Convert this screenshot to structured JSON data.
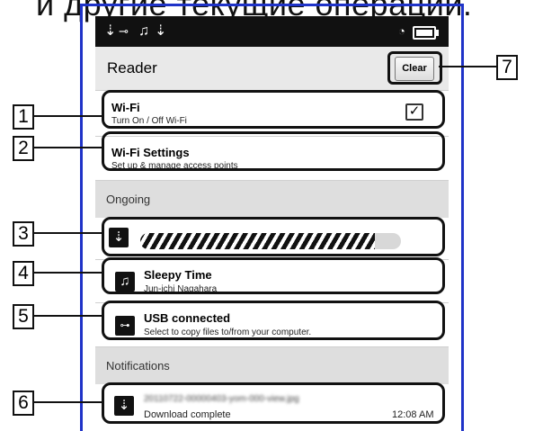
{
  "page": {
    "caption": "и другие текущие операции."
  },
  "status_bar": {
    "icons": [
      "download-icon",
      "usb-icon",
      "music-note-icon",
      "download-icon",
      "wireless-icon",
      "battery-icon"
    ]
  },
  "header": {
    "title": "Reader",
    "clear_label": "Clear"
  },
  "quick_settings": [
    {
      "title": "Wi-Fi",
      "subtitle": "Turn On / Off Wi-Fi",
      "checked": true
    },
    {
      "title": "Wi-Fi Settings",
      "subtitle": "Set up & manage access points"
    }
  ],
  "ongoing": {
    "label": "Ongoing",
    "download_progress": 0.9,
    "music": {
      "title": "Sleepy Time",
      "subtitle": "Jun-ichi Nagahara"
    },
    "usb": {
      "title": "USB connected",
      "subtitle": "Select to copy files to/from your computer."
    }
  },
  "notifications": {
    "label": "Notifications",
    "items": [
      {
        "title": "20110722-00000403-yom-000-view.jpg",
        "status": "Download complete",
        "time": "12:08 AM"
      }
    ]
  },
  "callouts": [
    "1",
    "2",
    "3",
    "4",
    "5",
    "6",
    "7"
  ],
  "colors": {
    "frame_blue": "#1f33c8",
    "statusbar_bg": "#111111",
    "header_bg": "#e9e9e9",
    "section_bg": "#dedede"
  }
}
